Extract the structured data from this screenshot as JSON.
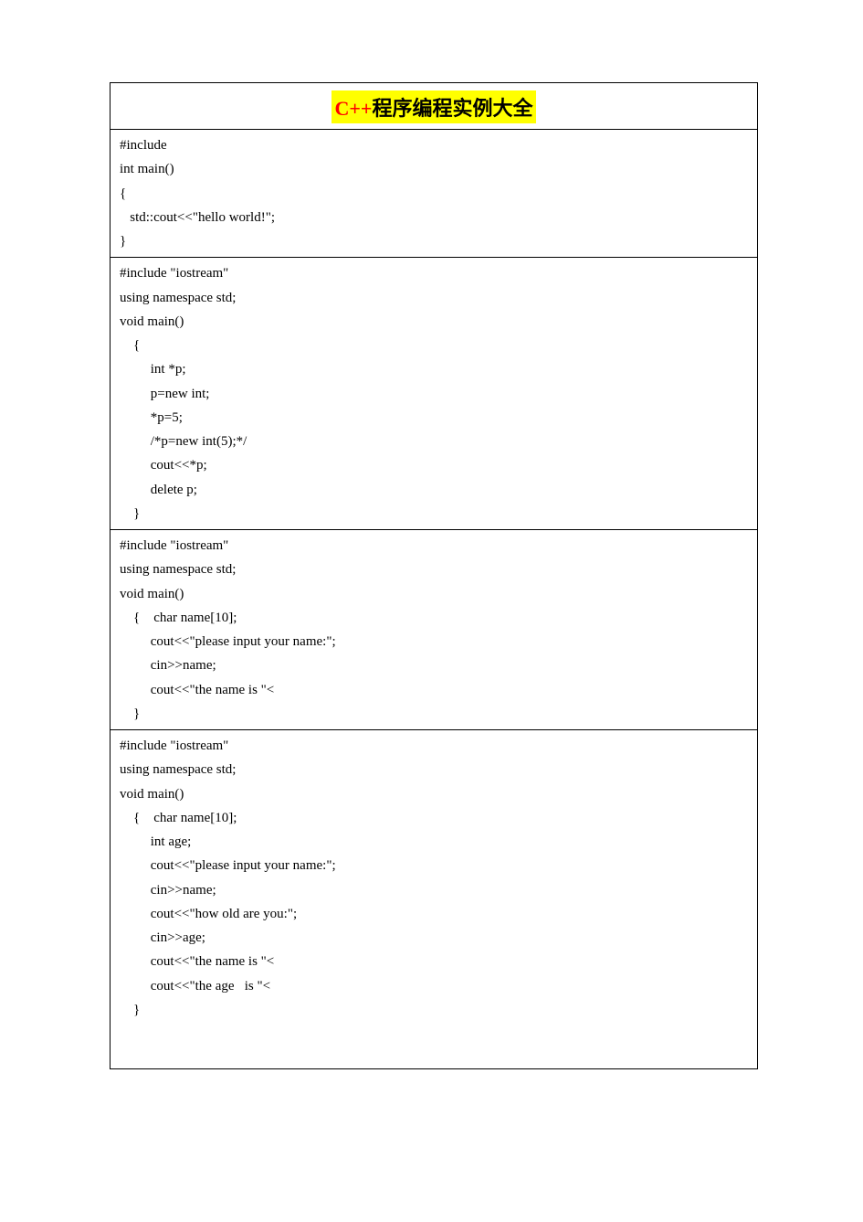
{
  "title": {
    "part1": "C++",
    "part2": "程序编程实例大全"
  },
  "blocks": [
    {
      "lines": [
        "#include",
        "int main()",
        "{",
        "   std::cout<<\"hello world!\";",
        "}"
      ]
    },
    {
      "lines": [
        "#include \"iostream\"",
        "using namespace std;",
        "void main()",
        "    {",
        "         int *p;",
        "         p=new int;",
        "         *p=5;",
        "         /*p=new int(5);*/",
        "         cout<<*p;",
        "         delete p;",
        "    }"
      ]
    },
    {
      "lines": [
        "#include \"iostream\"",
        "using namespace std;",
        "void main()",
        "    {    char name[10];",
        "         cout<<\"please input your name:\";",
        "         cin>>name;",
        "         cout<<\"the name is \"<",
        "    }"
      ]
    },
    {
      "lines": [
        "#include \"iostream\"",
        "using namespace std;",
        "void main()",
        "    {    char name[10];",
        "         int age;",
        "         cout<<\"please input your name:\";",
        "         cin>>name;",
        "         cout<<\"how old are you:\";",
        "         cin>>age;",
        "         cout<<\"the name is \"<",
        "         cout<<\"the age   is \"<",
        "    }"
      ]
    }
  ]
}
